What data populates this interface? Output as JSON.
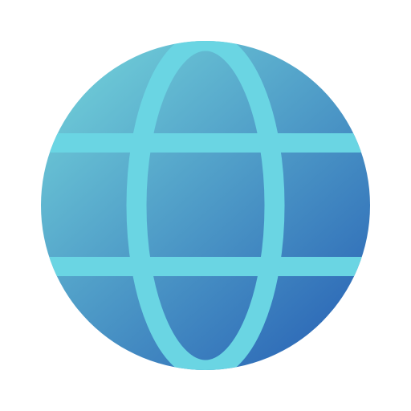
{
  "icon": {
    "name": "globe-icon",
    "colors": {
      "gradient_start": "#6cc8d6",
      "gradient_end": "#2f6cb8",
      "grid_lines": "#6ad5e3",
      "background": "#ffffff"
    }
  }
}
